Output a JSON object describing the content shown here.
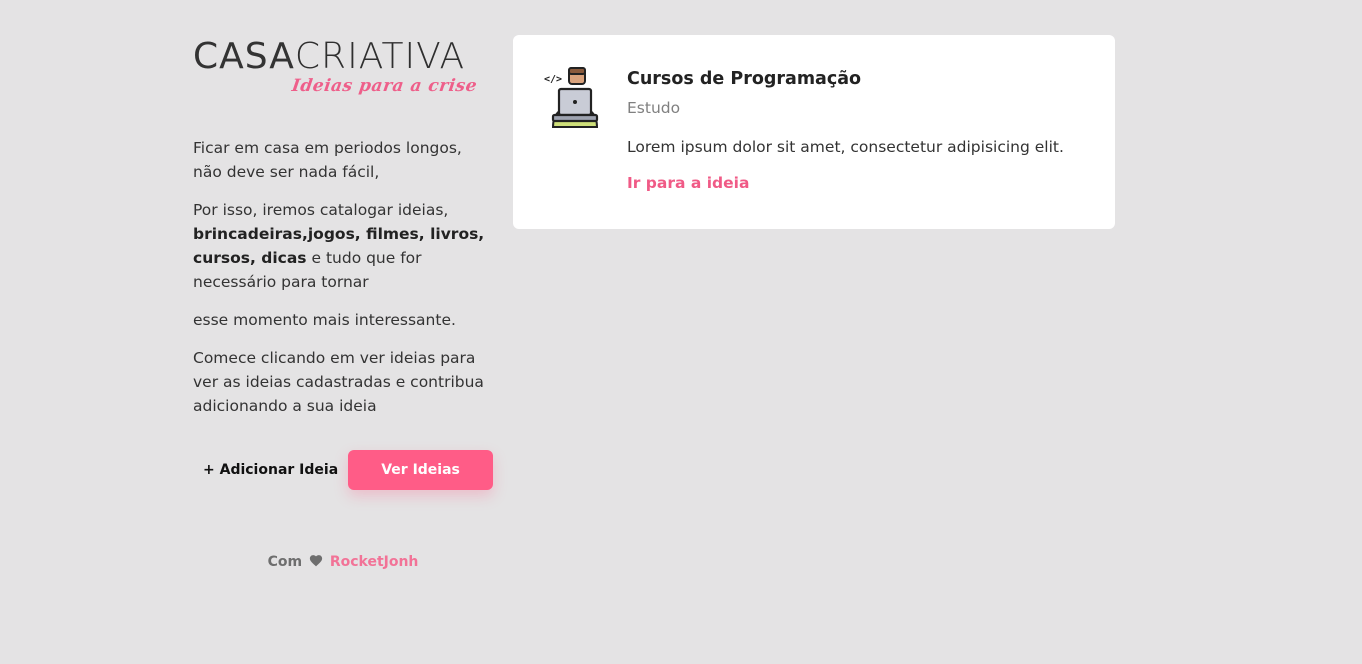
{
  "logo": {
    "casa": "CASA",
    "criativa": "CRIATIVA",
    "tagline": "Ideias para a crise"
  },
  "intro": {
    "p1": "Ficar em casa em periodos longos, não deve ser nada fácil,",
    "p2_start": "Por isso, iremos catalogar ideias,",
    "p2_bold": "brincadeiras,jogos, filmes, livros, cursos, dicas",
    "p2_end": "e tudo que for necessário para tornar",
    "p3": "esse momento mais interessante.",
    "p4": "Comece clicando em ver ideias para ver as ideias cadastradas e contribua adicionando a sua ideia"
  },
  "actions": {
    "add_label": "+ Adicionar Ideia",
    "view_label": "Ver Ideias"
  },
  "footer": {
    "prefix": "Com",
    "heart_icon": "heart-icon",
    "author": "RocketJonh"
  },
  "idea_card": {
    "icon": "programmer-laptop-icon",
    "title": "Cursos de Programação",
    "category": "Estudo",
    "description": "Lorem ipsum dolor sit amet, consectetur adipisicing elit.",
    "link_label": "Ir para a ideia"
  },
  "colors": {
    "background": "#e4e3e4",
    "accent": "#ff5c87",
    "card": "#ffffff"
  }
}
